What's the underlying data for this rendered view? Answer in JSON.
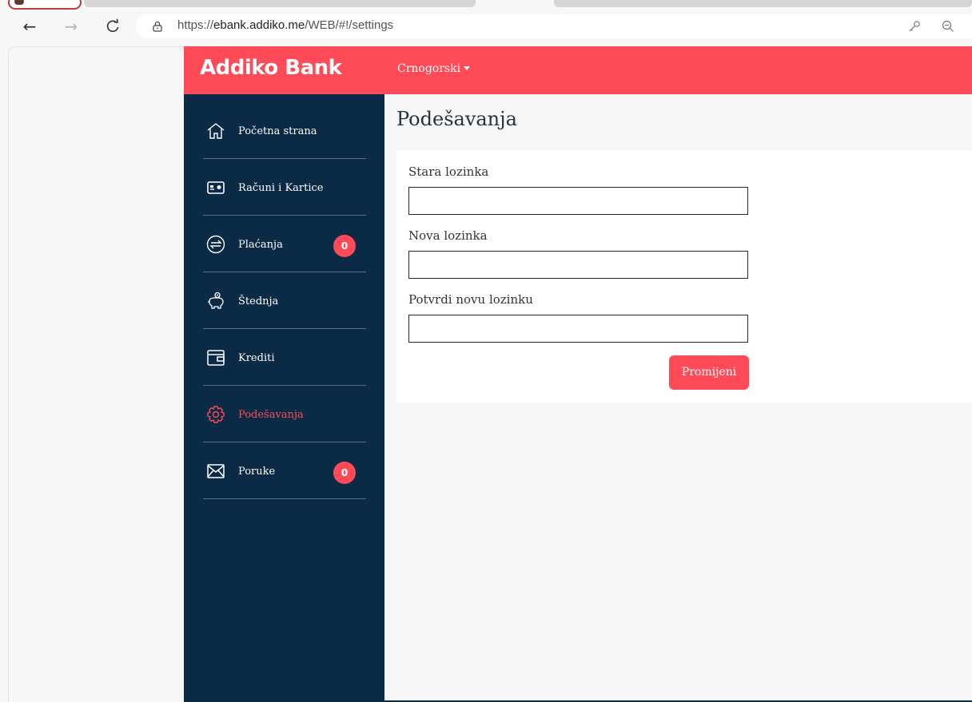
{
  "browser": {
    "url_prefix": "https://",
    "url_domain": "ebank.addiko.me",
    "url_path": "/WEB/#!/settings",
    "back_icon": "←",
    "forward_icon": "→",
    "reload_icon": "C"
  },
  "header": {
    "logo": "Addiko Bank",
    "language": "Crnogorski"
  },
  "sidebar": {
    "items": [
      {
        "label": "Početna strana",
        "icon": "home-icon"
      },
      {
        "label": "Računi i Kartice",
        "icon": "card-icon"
      },
      {
        "label": "Plaćanja",
        "icon": "transfer-icon",
        "badge": "0"
      },
      {
        "label": "Štednja",
        "icon": "piggy-bank-icon"
      },
      {
        "label": "Krediti",
        "icon": "wallet-icon"
      },
      {
        "label": "Podešavanja",
        "icon": "gear-icon",
        "active": true
      },
      {
        "label": "Poruke",
        "icon": "envelope-icon",
        "badge": "0"
      }
    ]
  },
  "main": {
    "title": "Podešavanja",
    "form": {
      "old_password_label": "Stara lozinka",
      "old_password_value": "",
      "new_password_label": "Nova lozinka",
      "new_password_value": "",
      "confirm_password_label": "Potvrdi novu lozinku",
      "confirm_password_value": "",
      "submit_label": "Promijeni"
    }
  },
  "colors": {
    "accent": "#ff4b57",
    "sidebar_bg": "#0b2a45"
  }
}
